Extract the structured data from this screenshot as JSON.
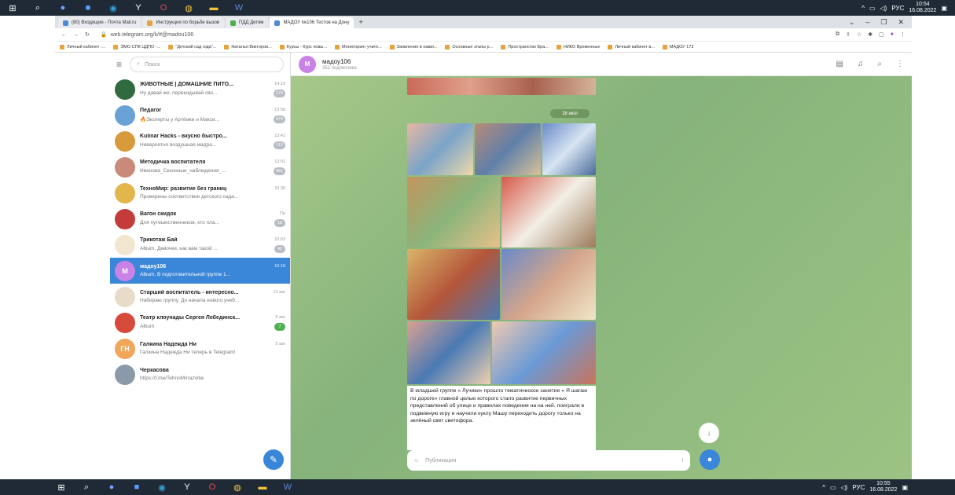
{
  "taskbar_top": {
    "icons": [
      "windows-icon",
      "search-icon",
      "app-icon",
      "store-icon",
      "edge-icon",
      "yandex-icon",
      "opera-icon",
      "chrome-icon",
      "files-icon",
      "word-icon"
    ],
    "tray_lang": "РУС",
    "time": "10:54",
    "date": "16.08.2022"
  },
  "taskbar_bottom": {
    "tray_lang": "РУС",
    "time": "10:55",
    "date": "16.08.2022"
  },
  "browser": {
    "tabs": [
      {
        "label": "(80) Входящие - Почта Mail.ru"
      },
      {
        "label": "Инструкция по борьбе вызов"
      },
      {
        "label": "ПДД Детям"
      },
      {
        "label": "МАДОУ №106 Тестов на Дону"
      }
    ],
    "new_tab": "+",
    "url": "web.telegram.org/k/#@madou106",
    "bookmarks": [
      "Личный кабинет -...",
      "ЭМО СПК ЦДПО -...",
      "\"Детский сад года\"...",
      "Наталья Викторов...",
      "Курсы - Курс повы...",
      "Мониторинг учите...",
      "Заявление в навиг...",
      "Основные этапы р...",
      "Пространство Бра...",
      "НИКО Временные",
      "Личный кабинет в...",
      "МАДОУ 173"
    ]
  },
  "sidebar": {
    "search_placeholder": "Поиск",
    "chats": [
      {
        "name": "ЖИВОТНЫЕ | ДОМАШНИЕ ПИТО...",
        "time": "14:19",
        "preview": "Ну давай же, перекидывай сво...",
        "badge": "270",
        "avatar_color": "#2f6b3e",
        "avatar_text": ""
      },
      {
        "name": "Педагог",
        "time": "13:58",
        "preview": "🔥Эксперты у Артёмки и Макси...",
        "badge": "474",
        "avatar_color": "#6aa2d6",
        "avatar_text": ""
      },
      {
        "name": "Kulinar Hacks - вкусно быстро...",
        "time": "13:41",
        "preview": "Невероятно воздушная мадра...",
        "badge": "112",
        "avatar_color": "#d89b3c",
        "avatar_text": ""
      },
      {
        "name": "Методичка воспитателя",
        "time": "13:01",
        "preview": "Иванова_Сезонные_наблюдения_...",
        "badge": "461",
        "avatar_color": "#c98a7a",
        "avatar_text": ""
      },
      {
        "name": "ТехноМир: развитие без границ",
        "time": "10:36",
        "preview": "Проверены соответствие детского сада...",
        "badge": "",
        "avatar_color": "#e2b64a",
        "avatar_text": ""
      },
      {
        "name": "Вагон скидок",
        "time": "Пн",
        "preview": "Для путешественников, кто пла...",
        "badge": "18",
        "avatar_color": "#c43b3b",
        "avatar_text": ""
      },
      {
        "name": "Трикотаж Бай",
        "time": "10:03",
        "preview": "Album, Девочки, как вам такой ...",
        "badge": "42",
        "avatar_color": "#f2e6d0",
        "avatar_text": ""
      },
      {
        "name": "мадоу106",
        "time": "10:18",
        "preview": "Album, В подготовительной группе 1...",
        "badge": "",
        "avatar_color": "#c983e6",
        "avatar_text": "M"
      },
      {
        "name": "Старший воспитатель - интересно...",
        "time": "13 авг",
        "preview": "Набираю группу. До начала нового учеб...",
        "badge": "",
        "avatar_color": "#e8dcc8",
        "avatar_text": ""
      },
      {
        "name": "Театр клоунады Сергея Лебединск...",
        "time": "9 авг",
        "preview": "Album",
        "badge": "7",
        "avatar_color": "#d64a3b",
        "avatar_text": ""
      },
      {
        "name": "Галкина Надежда Ни",
        "time": "5 авг",
        "preview": "Галкина Надежда Ни теперь в Telegram!",
        "badge": "",
        "avatar_color": "#f2a65a",
        "avatar_text": "ГН"
      },
      {
        "name": "Черкасова",
        "time": "",
        "preview": "https://t.me/TehnoMirrazvitie",
        "badge": "",
        "avatar_color": "#8a9aa8",
        "avatar_text": ""
      }
    ]
  },
  "channel": {
    "title": "мадоу106",
    "subscribers": "352 подписчика",
    "date_pill": "26 июл",
    "caption": "В младшей группе « Лучики» прошло тематическое занятие « Я шагаю по дороге» главной целью которого стало развитие первичных представлений об улице и правилах поведения на на ней. поиграли в подвижную игру и научили куклу Машу переходить дорогу только на зелёный свет светофора.",
    "compose_placeholder": "Публикация"
  }
}
